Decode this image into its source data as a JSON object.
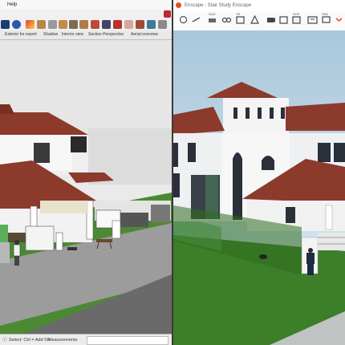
{
  "left_window": {
    "menu": {
      "item_1": "Help"
    },
    "tabs": [
      "Exterior for export",
      "Shadow",
      "Interior view",
      "Section Perspective",
      "Aerial overview"
    ],
    "status": {
      "hint": "Select: Ctrl = Add Sh",
      "measurements_label": "Measurements"
    },
    "toolbar_icons": [
      "select-icon",
      "info-icon",
      "paint-icon",
      "shapes-icon",
      "rect-icon",
      "pushpull-icon",
      "move-icon",
      "rotate-icon",
      "scale-icon",
      "tape-icon",
      "text-icon",
      "component-icon",
      "material-icon",
      "style-icon",
      "eraser-icon",
      "warehouse-icon",
      "extension-icon",
      "render-icon"
    ]
  },
  "right_window": {
    "title": "Enscape - Stair Study Enscape",
    "toolbar_labels": {
      "sun": "SUN",
      "vr": "VR",
      "screenshot": "SCR",
      "pano": "PAN"
    },
    "toolbar_icons": [
      "enscape-logo-icon",
      "sync-icon",
      "link-icon",
      "vr-glasses-icon",
      "time-icon",
      "view-icon",
      "camera-icon",
      "screenshot-icon",
      "batch-icon",
      "video-icon",
      "panorama-icon",
      "settings-icon",
      "help-icon"
    ]
  },
  "colors": {
    "accent": "#e84a22",
    "roof": "#8c3a2c",
    "grass": "#3f8a2d",
    "sky": "#cfe0ea"
  }
}
